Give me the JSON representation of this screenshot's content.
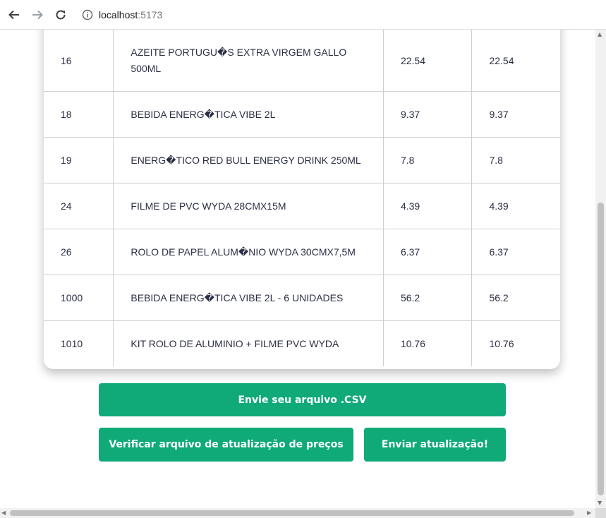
{
  "browser": {
    "url_host": "localhost",
    "url_port": ":5173"
  },
  "table": {
    "rows": [
      {
        "code": "16",
        "name": "AZEITE PORTUGU�S EXTRA VIRGEM GALLO 500ML",
        "current_price": "22.54",
        "new_price": "22.54"
      },
      {
        "code": "18",
        "name": "BEBIDA ENERG�TICA VIBE 2L",
        "current_price": "9.37",
        "new_price": "9.37"
      },
      {
        "code": "19",
        "name": "ENERG�TICO RED BULL ENERGY DRINK 250ML",
        "current_price": "7.8",
        "new_price": "7.8"
      },
      {
        "code": "24",
        "name": "FILME DE PVC WYDA 28CMX15M",
        "current_price": "4.39",
        "new_price": "4.39"
      },
      {
        "code": "26",
        "name": "ROLO DE PAPEL ALUM�NIO WYDA 30CMX7,5M",
        "current_price": "6.37",
        "new_price": "6.37"
      },
      {
        "code": "1000",
        "name": "BEBIDA ENERG�TICA VIBE 2L - 6 UNIDADES",
        "current_price": "56.2",
        "new_price": "56.2"
      },
      {
        "code": "1010",
        "name": "KIT ROLO DE ALUMINIO + FILME PVC WYDA",
        "current_price": "10.76",
        "new_price": "10.76"
      }
    ]
  },
  "actions": {
    "upload_label": "Envie seu arquivo .CSV",
    "validate_label": "Verificar arquivo de atualização de preços",
    "submit_label": "Enviar atualização!"
  },
  "colors": {
    "button": "#0faa78",
    "text": "#2b2f45"
  }
}
